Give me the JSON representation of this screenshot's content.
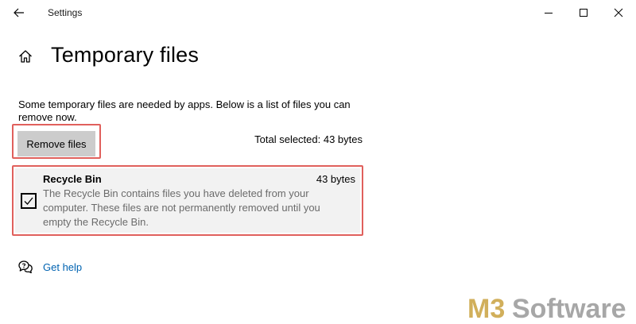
{
  "window": {
    "title": "Settings",
    "controls": [
      "minimize-icon",
      "maximize-icon",
      "close-icon"
    ]
  },
  "header": {
    "title": "Temporary files"
  },
  "description": "Some temporary files are needed by apps. Below is a list of files you can remove now.",
  "actions": {
    "remove_label": "Remove files",
    "total_selected": "Total selected: 43 bytes"
  },
  "items": [
    {
      "name": "Recycle Bin",
      "size": "43 bytes",
      "checked": true,
      "description": "The Recycle Bin contains files you have deleted from your computer. These files are not permanently removed until you empty the Recycle Bin."
    }
  ],
  "help": {
    "label": "Get help"
  },
  "watermark": {
    "text": "M3 Software"
  },
  "colors": {
    "highlight_outline": "#e0605c",
    "link": "#0063b1",
    "button_bg": "#cccccc",
    "item_bg": "#f2f2f2",
    "watermark_gold": "#c9a23f",
    "watermark_gray": "#8a8a8a"
  }
}
